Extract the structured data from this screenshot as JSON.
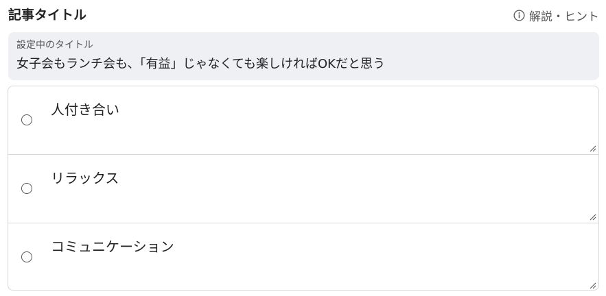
{
  "header": {
    "title": "記事タイトル",
    "hint_label": "解説・ヒント",
    "hint_icon": "info-circle-icon"
  },
  "current_title": {
    "label": "設定中のタイトル",
    "value": "女子会もランチ会も、「有益」じゃなくても楽しければOKだと思う"
  },
  "options": [
    {
      "text": "人付き合い",
      "selected": false
    },
    {
      "text": "リラックス",
      "selected": false
    },
    {
      "text": "コミュニケーション",
      "selected": false
    }
  ],
  "colors": {
    "text": "#222222",
    "muted": "#555555",
    "panel_bg": "#eef0f3",
    "border": "#d6d6d6"
  }
}
